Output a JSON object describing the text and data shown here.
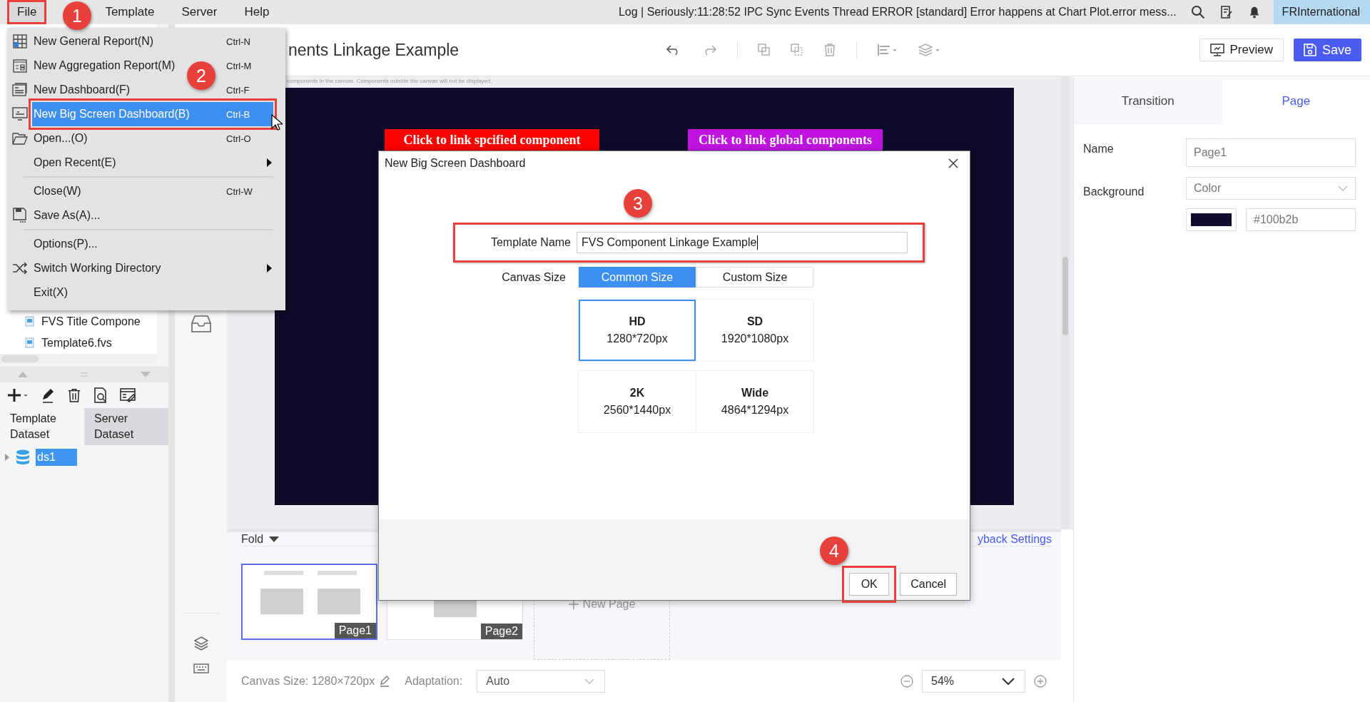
{
  "menu_bar": {
    "items": [
      {
        "label": "File",
        "selected": true
      },
      {
        "label": "Template",
        "selected": false
      },
      {
        "label": "Server",
        "selected": false
      },
      {
        "label": "Help",
        "selected": false
      }
    ],
    "log": "Log | Seriously:11:28:52 IPC Sync Events Thread ERROR [standard] Error happens at Chart Plot.error mess...",
    "user": "FRInternational"
  },
  "file_menu": {
    "items": [
      {
        "kind": "item",
        "label": "New General Report(N)",
        "shortcut": "Ctrl-N",
        "submenu": false,
        "selected": false
      },
      {
        "kind": "item",
        "label": "New Aggregation Report(M)",
        "shortcut": "Ctrl-M",
        "submenu": false,
        "selected": false
      },
      {
        "kind": "item",
        "label": "New Dashboard(F)",
        "shortcut": "Ctrl-F",
        "submenu": false,
        "selected": false
      },
      {
        "kind": "item",
        "label": "New Big Screen Dashboard(B)",
        "shortcut": "Ctrl-B",
        "submenu": false,
        "selected": true
      },
      {
        "kind": "item",
        "label": "Open...(O)",
        "shortcut": "Ctrl-O",
        "submenu": false,
        "selected": false
      },
      {
        "kind": "item",
        "label": "Open Recent(E)",
        "submenu": true,
        "selected": false
      },
      {
        "kind": "separator"
      },
      {
        "kind": "item",
        "label": "Close(W)",
        "shortcut": "Ctrl-W",
        "submenu": false,
        "selected": false
      },
      {
        "kind": "item",
        "label": "Save As(A)...",
        "submenu": false,
        "selected": false
      },
      {
        "kind": "separator"
      },
      {
        "kind": "item",
        "label": "Options(P)...",
        "submenu": false,
        "selected": false
      },
      {
        "kind": "item",
        "label": "Switch Working Directory",
        "submenu": true,
        "selected": false
      },
      {
        "kind": "item",
        "label": "Exit(X)",
        "submenu": false,
        "selected": false
      }
    ]
  },
  "annotations": [
    {
      "label": "1"
    },
    {
      "label": "2"
    },
    {
      "label": "3"
    },
    {
      "label": "4"
    }
  ],
  "left_panel": {
    "files": [
      {
        "name": "FVS Title Compone"
      },
      {
        "name": "Template6.fvs"
      }
    ],
    "tabs": [
      {
        "label": "Template Dataset",
        "selected": true
      },
      {
        "label": "Server Dataset",
        "selected": false
      }
    ],
    "datasets": [
      {
        "name": "ds1",
        "selected": true,
        "expanded": false
      }
    ]
  },
  "document": {
    "title": "nents Linkage Example",
    "buttons": [
      {
        "label": "Preview"
      },
      {
        "label": "Save"
      }
    ]
  },
  "canvas": {
    "hint": "components in the canvas. Components outside the canvas will not be displayed.",
    "color": "#100b2b",
    "buttons": [
      {
        "label": "Click to link spcified component",
        "color": "#ff0000"
      },
      {
        "label": "Click to link global components",
        "color": "#c013e0"
      }
    ]
  },
  "pages": {
    "fold": "Fold",
    "playback": "yback Settings",
    "new_page": "New Page",
    "items": [
      {
        "label": "Page1",
        "selected": true
      },
      {
        "label": "Page2",
        "selected": false
      }
    ]
  },
  "status_bar": {
    "canvas_size": "Canvas Size: 1280×720px",
    "adaptation_label": "Adaptation:",
    "adaptation": "Auto",
    "zoom": "54%"
  },
  "properties": {
    "tabs": [
      {
        "label": "Transition",
        "selected": false
      },
      {
        "label": "Page",
        "selected": true
      }
    ],
    "name_label": "Name",
    "name": "Page1",
    "background_label": "Background",
    "background": "Color",
    "color": "#100b2b",
    "hex": "#100b2b"
  },
  "dialog": {
    "title": "New Big Screen Dashboard",
    "template_label": "Template Name",
    "template_value": "FVS Component Linkage Example",
    "canvas_label": "Canvas Size",
    "tabs": [
      {
        "label": "Common Size",
        "selected": true
      },
      {
        "label": "Custom Size",
        "selected": false
      }
    ],
    "options": [
      {
        "name": "HD",
        "size": "1280*720px",
        "selected": true
      },
      {
        "name": "SD",
        "size": "1920*1080px",
        "selected": false
      },
      {
        "name": "2K",
        "size": "2560*1440px",
        "selected": false
      },
      {
        "name": "Wide",
        "size": "4864*1294px",
        "selected": false
      }
    ],
    "buttons": [
      {
        "label": "OK"
      },
      {
        "label": "Cancel"
      }
    ]
  }
}
